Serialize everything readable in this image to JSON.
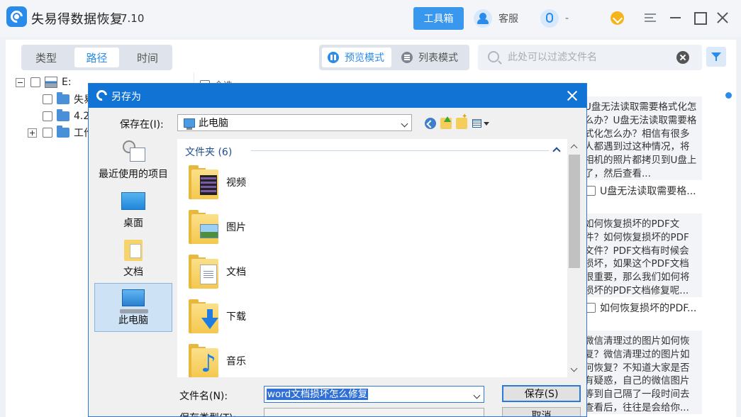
{
  "app": {
    "title": "失易得数据恢复",
    "version": "7.10",
    "toolbox_label": "工具箱",
    "service_label": "客服",
    "qq_label": "-"
  },
  "toolbar": {
    "tabs": [
      "类型",
      "路径",
      "时间"
    ],
    "active_tab": "路径",
    "view_modes": [
      "预览模式",
      "列表模式"
    ],
    "active_view": "预览模式",
    "search_placeholder": "此处可以过滤文件名"
  },
  "tree": {
    "drive": "E:",
    "items": [
      "失易",
      "4.2",
      "工作"
    ]
  },
  "list_header": {
    "select_all": "全选"
  },
  "cards": [
    {
      "text": "U盘无法读取需要格式化怎么办？U盘无法读取需要格式化怎么办？相信有很多人都遇到过这种情况，将相机的照片都拷贝到U盘上了，然后查看...",
      "name": "U盘无法读取需要格..."
    },
    {
      "text": "如何恢复损坏的PDF文件？如何恢复损坏的PDF文件？PDF文档有时候会损坏，如果这个PDF文档很重要，那么我们如何将损坏的PDF文档修复呢...",
      "name": "如何恢复损坏的PDF..."
    },
    {
      "text": "微信清理过的图片如何恢复？微信清理过的图片如何恢复？不知道大家是否有疑惑，自己的微信图片等到自己隔了一段时间去查看后，往往是会给你...",
      "name": ""
    }
  ],
  "dialog": {
    "title": "另存为",
    "save_in_label": "保存在(I):",
    "save_in_value": "此电脑",
    "places": [
      "最近使用的项目",
      "桌面",
      "文档",
      "此电脑"
    ],
    "active_place": "此电脑",
    "group_header": "文件夹 (6)",
    "folders": [
      {
        "name": "视频",
        "icon": "video-folder-icon"
      },
      {
        "name": "图片",
        "icon": "pictures-folder-icon"
      },
      {
        "name": "文档",
        "icon": "documents-folder-icon"
      },
      {
        "name": "下载",
        "icon": "downloads-folder-icon"
      },
      {
        "name": "音乐",
        "icon": "music-folder-icon"
      }
    ],
    "filename_label": "文件名(N):",
    "filename_value": "word文档损坏怎么修复",
    "filetype_label": "保存类型(T):",
    "save_button": "保存(S)",
    "cancel_button": "取消"
  },
  "colors": {
    "accent": "#2a8bea",
    "dialog_title": "#1173d4",
    "selection": "#2f6fd6"
  }
}
